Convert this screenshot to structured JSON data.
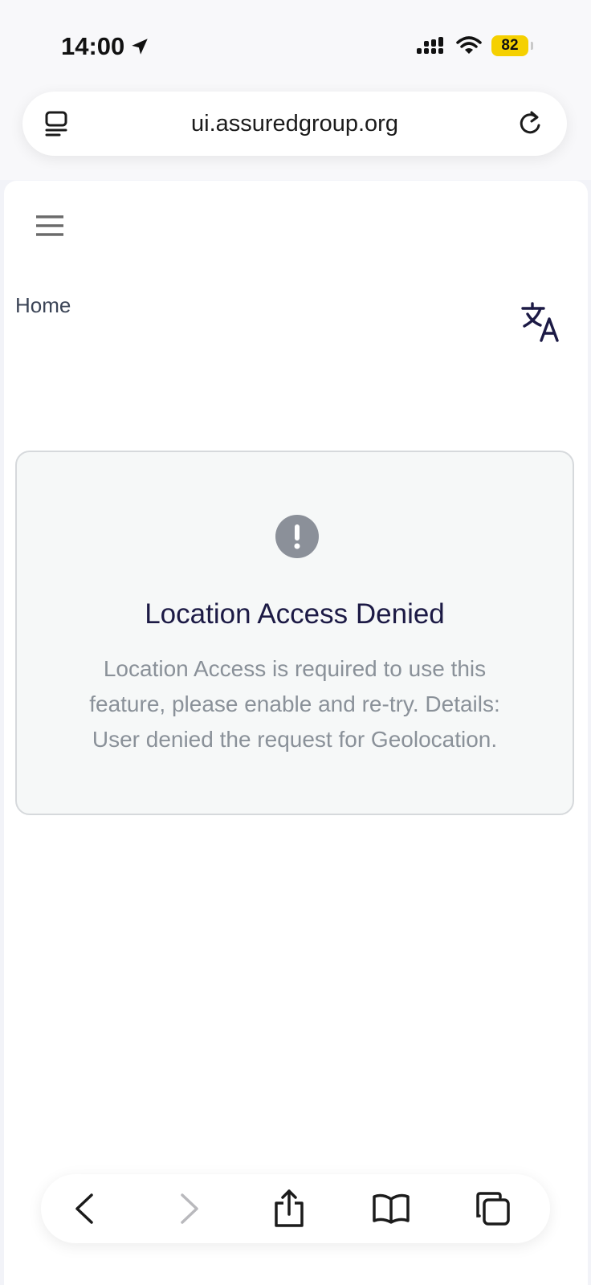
{
  "status_bar": {
    "time": "14:00",
    "battery": "82",
    "icons": [
      "location-arrow-icon",
      "cellular-signal-icon",
      "wifi-icon",
      "battery-icon"
    ]
  },
  "browser": {
    "url": "ui.assuredgroup.org",
    "address_icons": [
      "tab-overview-icon",
      "reload-icon"
    ],
    "toolbar_icons": [
      "back-arrow-icon",
      "forward-arrow-icon",
      "share-icon",
      "bookmarks-icon",
      "tabs-icon"
    ]
  },
  "nav": {
    "home_label": "Home",
    "icons": [
      "hamburger-menu-icon",
      "translate-icon"
    ]
  },
  "alert": {
    "title": "Location Access Denied",
    "message": "Location Access is required to use this feature, please enable and re-try. Details: User denied the request for Geolocation.",
    "icon": "exclamation-circle-icon"
  },
  "colors": {
    "page_background": "#ffffff",
    "card_background": "#f6f8f8",
    "title_color": "#1c1a45",
    "message_color": "#8a9199",
    "battery_color": "#f5d000"
  }
}
